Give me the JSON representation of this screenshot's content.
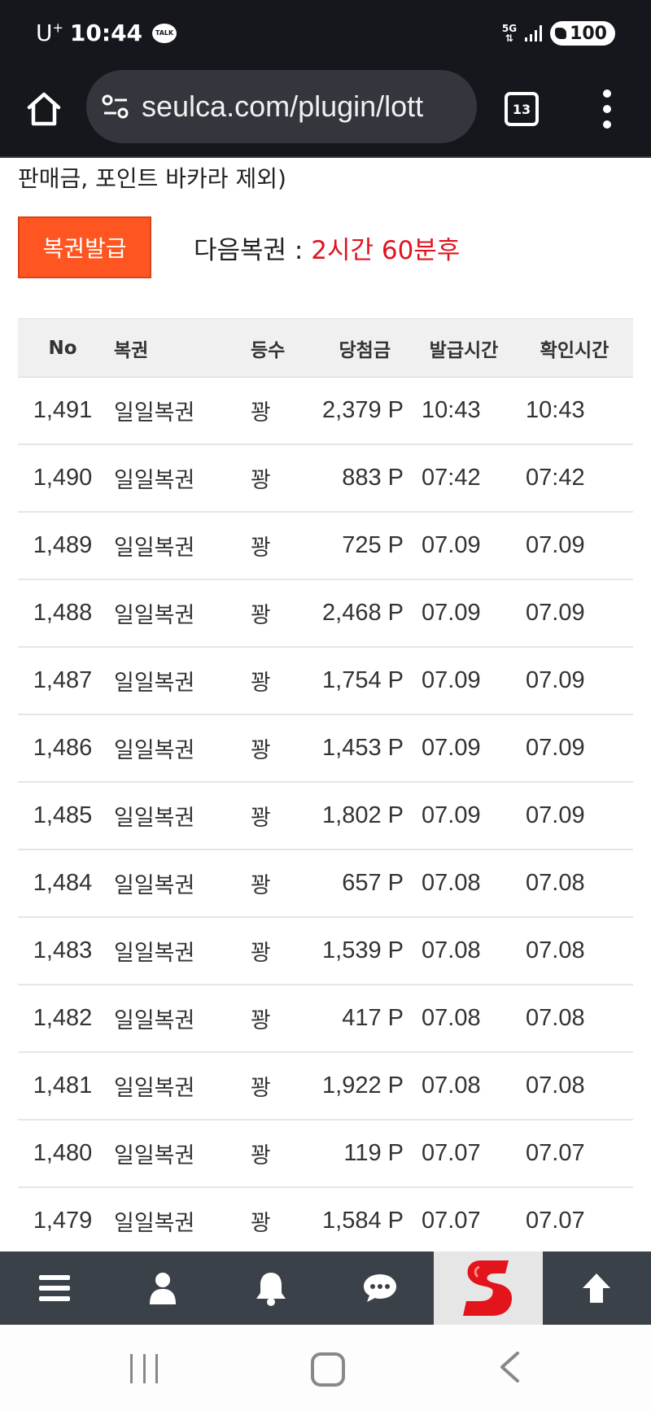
{
  "status_bar": {
    "carrier": "U",
    "carrier_sup": "+",
    "time": "10:44",
    "talk_badge": "TALK",
    "network": "5G",
    "battery": "100"
  },
  "browser": {
    "url": "seulca.com/plugin/lott",
    "tab_count": "13"
  },
  "page": {
    "notice_text": "판매금, 포인트 바카라 제외)",
    "issue_button_label": "복권발급",
    "next_ticket_label": "다음복권 : ",
    "next_ticket_time": "2시간 60분후"
  },
  "table": {
    "headers": [
      "No",
      "복권",
      "등수",
      "당첨금",
      "발급시간",
      "확인시간"
    ],
    "rows": [
      [
        "1,491",
        "일일복권",
        "꽝",
        "2,379 P",
        "10:43",
        "10:43"
      ],
      [
        "1,490",
        "일일복권",
        "꽝",
        "883 P",
        "07:42",
        "07:42"
      ],
      [
        "1,489",
        "일일복권",
        "꽝",
        "725 P",
        "07.09",
        "07.09"
      ],
      [
        "1,488",
        "일일복권",
        "꽝",
        "2,468 P",
        "07.09",
        "07.09"
      ],
      [
        "1,487",
        "일일복권",
        "꽝",
        "1,754 P",
        "07.09",
        "07.09"
      ],
      [
        "1,486",
        "일일복권",
        "꽝",
        "1,453 P",
        "07.09",
        "07.09"
      ],
      [
        "1,485",
        "일일복권",
        "꽝",
        "1,802 P",
        "07.09",
        "07.09"
      ],
      [
        "1,484",
        "일일복권",
        "꽝",
        "657 P",
        "07.08",
        "07.08"
      ],
      [
        "1,483",
        "일일복권",
        "꽝",
        "1,539 P",
        "07.08",
        "07.08"
      ],
      [
        "1,482",
        "일일복권",
        "꽝",
        "417 P",
        "07.08",
        "07.08"
      ],
      [
        "1,481",
        "일일복권",
        "꽝",
        "1,922 P",
        "07.08",
        "07.08"
      ],
      [
        "1,480",
        "일일복권",
        "꽝",
        "119 P",
        "07.07",
        "07.07"
      ],
      [
        "1,479",
        "일일복권",
        "꽝",
        "1,584 P",
        "07.07",
        "07.07"
      ]
    ]
  },
  "bottom_nav": {
    "items": [
      "menu-icon",
      "user-icon",
      "bell-icon",
      "chat-icon",
      "site-logo",
      "arrow-up-icon"
    ],
    "logo_color": "#e3141b"
  },
  "colors": {
    "accent": "#ff5520",
    "highlight_red": "#e0141e",
    "dark_bar": "#15171c",
    "nav_bg": "#3a4149"
  }
}
